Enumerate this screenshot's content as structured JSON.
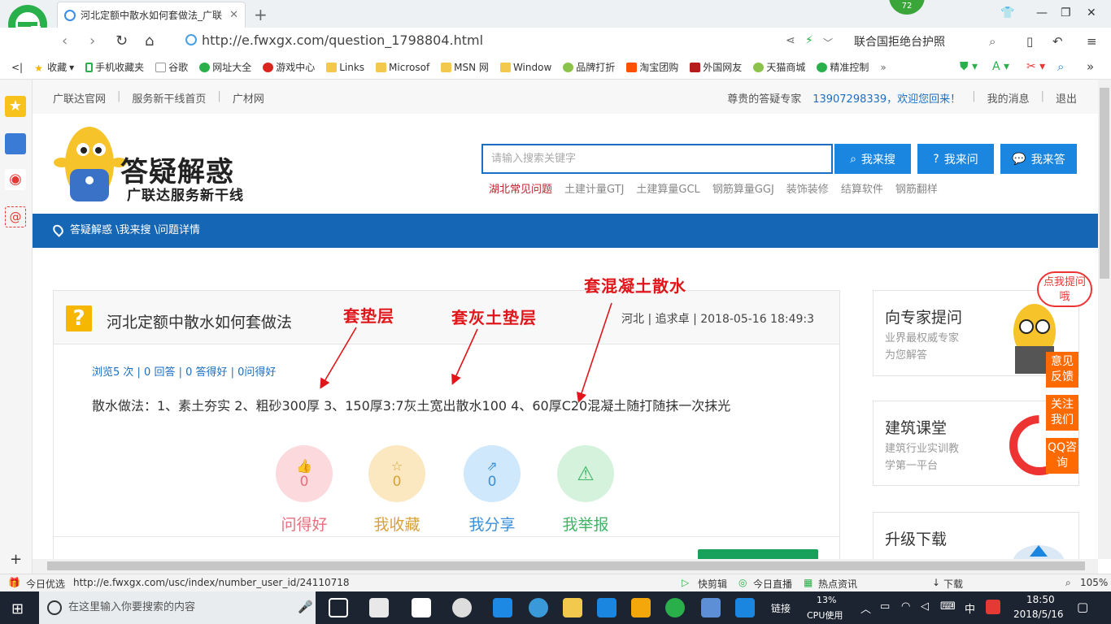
{
  "browser": {
    "tab_title": "河北定额中散水如何套做法_广联",
    "url": "http://e.fwxgx.com/question_1798804.html",
    "badge_count": "72",
    "search_placeholder": "联合国拒绝台护照",
    "bookmarks": [
      "收藏",
      "手机收藏夹",
      "谷歌",
      "网址大全",
      "游戏中心",
      "Links",
      "Microsof",
      "MSN 网",
      "Window",
      "品牌打折",
      "淘宝团购",
      "外国网友",
      "天猫商城",
      "精准控制"
    ]
  },
  "page": {
    "topnav_left": [
      "广联达官网",
      "服务新干线首页",
      "广材网"
    ],
    "user_greeting": "尊贵的答疑专家",
    "user_phone": "13907298339，欢迎您回来！",
    "my_messages": "我的消息",
    "logout": "退出",
    "brand_title": "答疑解惑",
    "brand_subtitle": "广联达服务新干线",
    "search_placeholder": "请输入搜索关键字",
    "btn_search": "我来搜",
    "btn_ask": "我来问",
    "btn_answer": "我来答",
    "hot_links": [
      "湖北常见问题",
      "土建计量GTJ",
      "土建算量GCL",
      "钢筋算量GGJ",
      "装饰装修",
      "结算软件",
      "钢筋翻样"
    ],
    "breadcrumb": "答疑解惑 \\我来搜 \\问题详情"
  },
  "question": {
    "title": "河北定额中散水如何套做法",
    "meta": "河北 | 追求卓 | 2018-05-16 18:49:3",
    "stats": "浏览5 次 | 0 回答 | 0 答得好 | 0问得好",
    "answer": "散水做法：1、素土夯实   2、粗砂300厚  3、150厚3:7灰土宽出散水100   4、60厚C20混凝土随打随抹一次抹光",
    "actions": [
      {
        "count": "0",
        "label": "问得好"
      },
      {
        "count": "0",
        "label": "我收藏"
      },
      {
        "count": "0",
        "label": "我分享"
      },
      {
        "label": "我举报"
      }
    ]
  },
  "annotations": [
    "套垫层",
    "套灰土垫层",
    "套混凝土散水"
  ],
  "sidebar": {
    "expert": {
      "title": "向专家提问",
      "line1": "业界最权威专家",
      "line2": "为您解答",
      "bubble": "点我提问哦"
    },
    "course": {
      "title": "建筑课堂",
      "line1": "建筑行业实训教",
      "line2": "学第一平台"
    },
    "download": {
      "title": "升级下载"
    },
    "float_btns": [
      "意见反馈",
      "关注我们",
      "QQ咨询"
    ]
  },
  "statusbar": {
    "left": "今日优选",
    "url": "http://e.fwxgx.com/usc/index/number_user_id/24110718",
    "items": [
      "快剪辑",
      "今日直播",
      "热点资讯",
      "下载"
    ],
    "zoom": "105%"
  },
  "taskbar": {
    "search_placeholder": "在这里输入你要搜索的内容",
    "link_label": "链接",
    "cpu": "13%",
    "cpu_label": "CPU使用",
    "ime": "中",
    "time": "18:50",
    "date": "2018/5/16"
  },
  "colors": {
    "accent": "#1566b4",
    "button": "#1a86e0",
    "annotation": "#e0161a",
    "float": "#ff6a00"
  }
}
